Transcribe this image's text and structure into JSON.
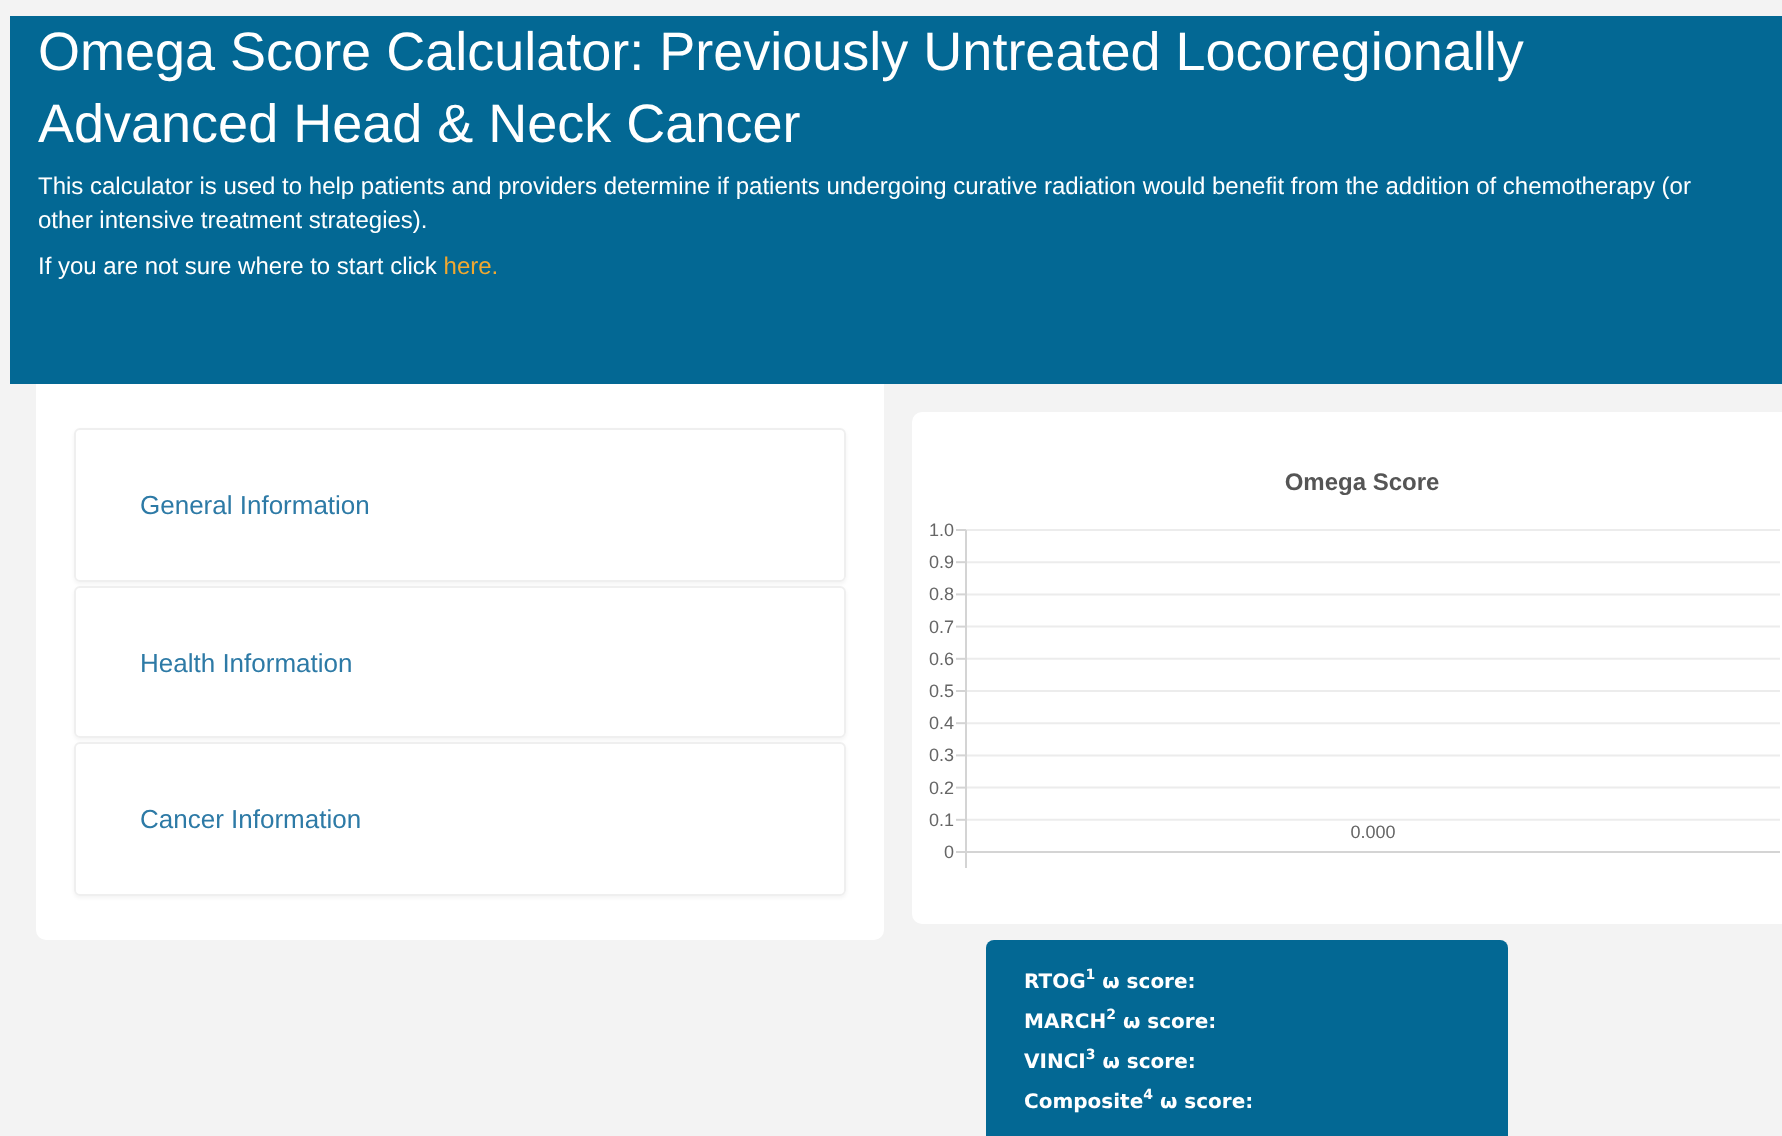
{
  "header": {
    "title": "Omega Score Calculator: Previously Untreated Locoregionally Advanced Head & Neck Cancer",
    "description": "This calculator is used to help patients and providers determine if patients undergoing curative radiation would benefit from the addition of chemotherapy (or other intensive treatment strategies).",
    "hint": "If you are not sure where to start click",
    "link": "here."
  },
  "sections": [
    {
      "label": "General Information"
    },
    {
      "label": "Health Information"
    },
    {
      "label": "Cancer Information"
    }
  ],
  "chart": {
    "chart_data": {
      "type": "bar",
      "title": "Omega Score",
      "values": [
        0
      ],
      "ylim": [
        0,
        1
      ],
      "yticks": [
        0,
        {
          "value": 0.1,
          "label": "0.1"
        },
        {
          "value": 0.2,
          "label": "0.2"
        },
        {
          "value": 0.3,
          "label": "0.3"
        },
        {
          "value": 0.4,
          "label": "0.4"
        },
        {
          "value": 0.5,
          "label": "0.5"
        },
        {
          "value": 0.6,
          "label": "0.6"
        },
        {
          "value": 0.7,
          "label": "0.7"
        },
        {
          "value": 0.8,
          "label": "0.8"
        },
        {
          "value": 0.9,
          "label": "0.9"
        },
        {
          "value": 1,
          "label": "1.0"
        }
      ],
      "value_labels": [
        "0.000"
      ],
      "grid": true
    }
  },
  "scores": [
    "RTOG$^{1}$ ω score:",
    "MARCH$^{2}$ ω score:",
    "VINCI$^{3}$ ω score:",
    "Composite$^{4}$ ω score:"
  ]
}
